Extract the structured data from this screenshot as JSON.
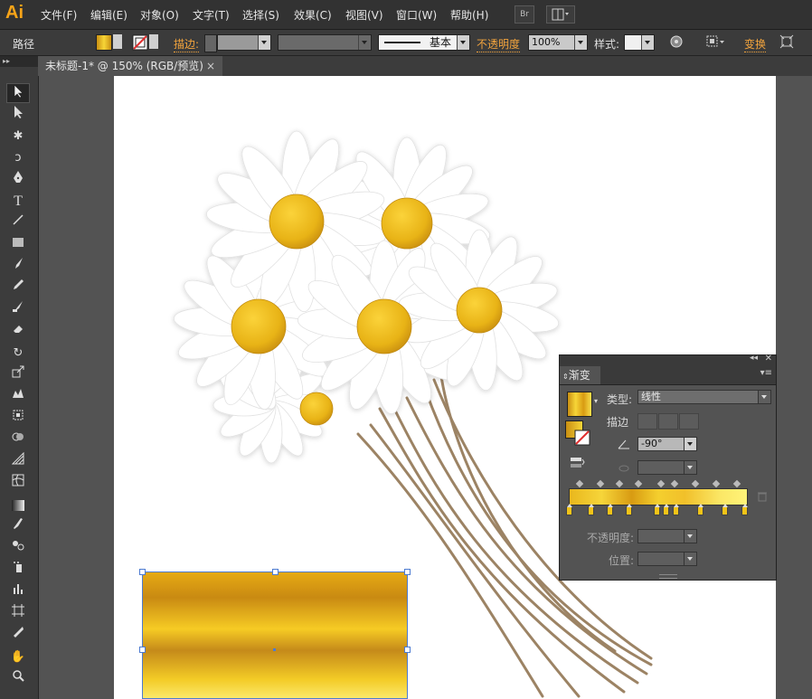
{
  "app": {
    "logo": "Ai",
    "accent": "#f7a418"
  },
  "menu": [
    "文件(F)",
    "编辑(E)",
    "对象(O)",
    "文字(T)",
    "选择(S)",
    "效果(C)",
    "视图(V)",
    "窗口(W)",
    "帮助(H)"
  ],
  "menubar_buttons": {
    "bridge": "Br"
  },
  "control_bar": {
    "selection_label": "路径",
    "stroke_label": "描边:",
    "stroke_style_label": "基本",
    "opacity_label": "不透明度",
    "opacity_value": "100%",
    "style_label": "样式:",
    "transform_label": "变换"
  },
  "document_tab": {
    "title": "未标题-1* @ 150% (RGB/预览)",
    "close": "×"
  },
  "gradient_panel": {
    "title": "渐变",
    "type_label": "类型:",
    "type_value": "线性",
    "stroke_label": "描边",
    "angle_value": "-90°",
    "opacity_label": "不透明度:",
    "position_label": "位置:",
    "gradient_stop_count": 10
  },
  "colors": {
    "canvas": "#ffffff",
    "ui_dark": "#535353",
    "gold": "#f2c418"
  }
}
